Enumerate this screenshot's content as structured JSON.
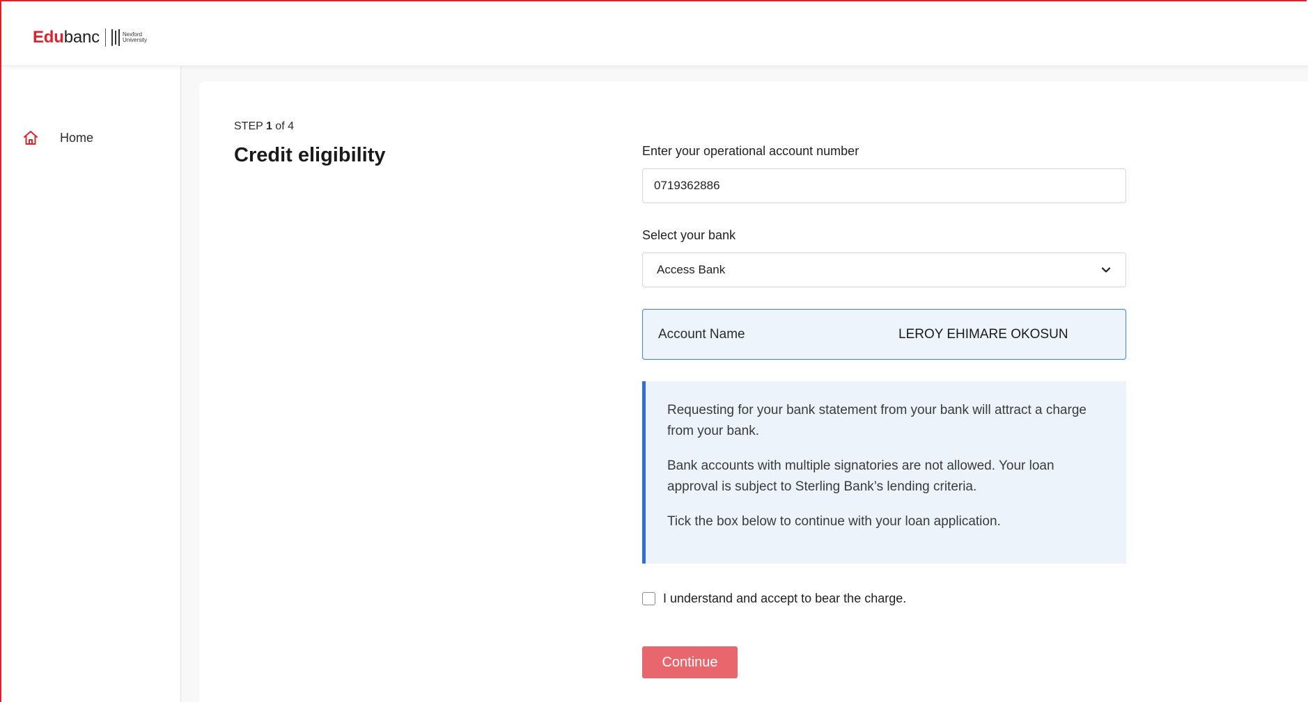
{
  "brand": {
    "name_part1": "Edu",
    "name_part2": "banc",
    "partner_line1": "Nexford",
    "partner_line2": "University",
    "accent_color": "#d9232e"
  },
  "sidebar": {
    "items": [
      {
        "label": "Home",
        "icon": "home-icon"
      }
    ]
  },
  "main": {
    "step_prefix": "STEP ",
    "step_current": "1",
    "step_suffix": " of 4",
    "title": "Credit eligibility"
  },
  "form": {
    "account_number_label": "Enter your operational account number",
    "account_number_value": "0719362886",
    "bank_label": "Select your bank",
    "bank_value": "Access Bank",
    "account_name_label": "Account Name",
    "account_name_value": "LEROY EHIMARE OKOSUN",
    "notice": [
      "Requesting for your bank statement from your bank will attract a charge from your bank.",
      "Bank accounts with multiple signatories are not allowed. Your loan approval is subject to Sterling Bank’s lending criteria.",
      "Tick the box below to continue with your loan application."
    ],
    "consent_label": "I understand and accept to bear the charge.",
    "consent_checked": false,
    "continue_label": "Continue",
    "continue_color": "#e8676d",
    "info_border_color": "#2f6fd6"
  }
}
